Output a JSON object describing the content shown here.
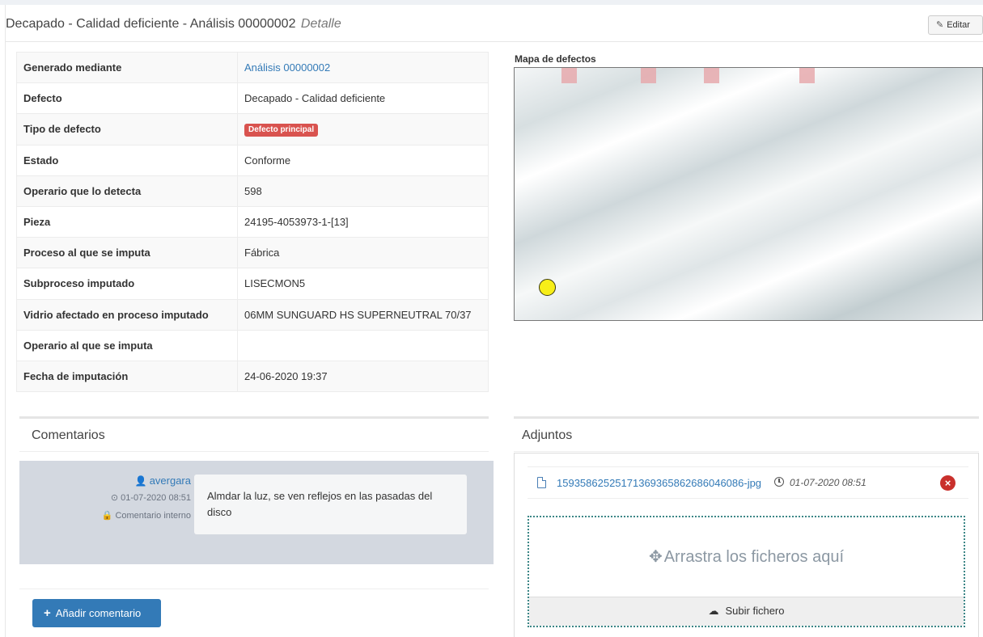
{
  "header": {
    "title": "Decapado - Calidad deficiente - Análisis 00000002",
    "title_suffix": "Detalle",
    "edit_label": "Editar"
  },
  "details": [
    {
      "key": "Generado mediante",
      "value": "Análisis 00000002",
      "is_link": true
    },
    {
      "key": "Defecto",
      "value": "Decapado - Calidad deficiente"
    },
    {
      "key": "Tipo de defecto",
      "value": "Defecto principal",
      "is_badge": true,
      "badge_color": "#d9534f"
    },
    {
      "key": "Estado",
      "value": "Conforme"
    },
    {
      "key": "Operario que lo detecta",
      "value": "598"
    },
    {
      "key": "Pieza",
      "value": "24195-4053973-1-[13]"
    },
    {
      "key": "Proceso al que se imputa",
      "value": "Fábrica"
    },
    {
      "key": "Subproceso imputado",
      "value": "LISECMON5"
    },
    {
      "key": "Vidrio afectado en proceso imputado",
      "value": "06MM SUNGUARD HS SUPERNEUTRAL 70/37"
    },
    {
      "key": "Operario al que se imputa",
      "value": ""
    },
    {
      "key": "Fecha de imputación",
      "value": "24-06-2020 19:37"
    }
  ],
  "defect_map": {
    "label": "Mapa de defectos",
    "marker_color": "#e6a9ad",
    "point_color": "#f7ee18"
  },
  "comments": {
    "title": "Comentarios",
    "items": [
      {
        "user": "avergara",
        "date": "01-07-2020 08:51",
        "visibility": "Comentario interno",
        "text": "Almdar la luz, se ven reflejos en las pasadas del disco"
      }
    ],
    "add_label": "Añadir comentario"
  },
  "attachments": {
    "title": "Adjuntos",
    "files": [
      {
        "name": "1593586252517136936586268604608​6-jpg",
        "date": "01-07-2020 08:51"
      }
    ],
    "drop_text": "Arrastra los ficheros aquí",
    "upload_label": "Subir fichero"
  },
  "colors": {
    "link": "#337ab7",
    "danger": "#d9534f",
    "primary": "#337ab7",
    "comment_bg": "#d3d8e0"
  }
}
